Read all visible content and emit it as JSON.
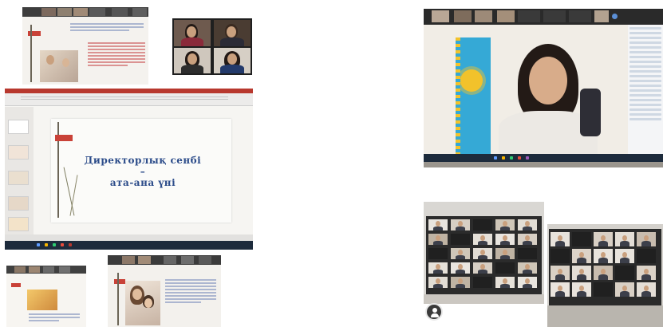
{
  "slide": {
    "title_line1": "Директорлық сенбі –",
    "title_line2": "ата-ана үні"
  },
  "icons": {
    "camera": "person-camera-icon"
  },
  "colors": {
    "slide_title": "#2c4c8a",
    "slide_accent_red": "#c94238",
    "taskbar": "#1d2b3c",
    "video_grid_bg": "#2b2b2b",
    "flag_blue": "#35a9d6",
    "flag_gold": "#f2c22b"
  }
}
